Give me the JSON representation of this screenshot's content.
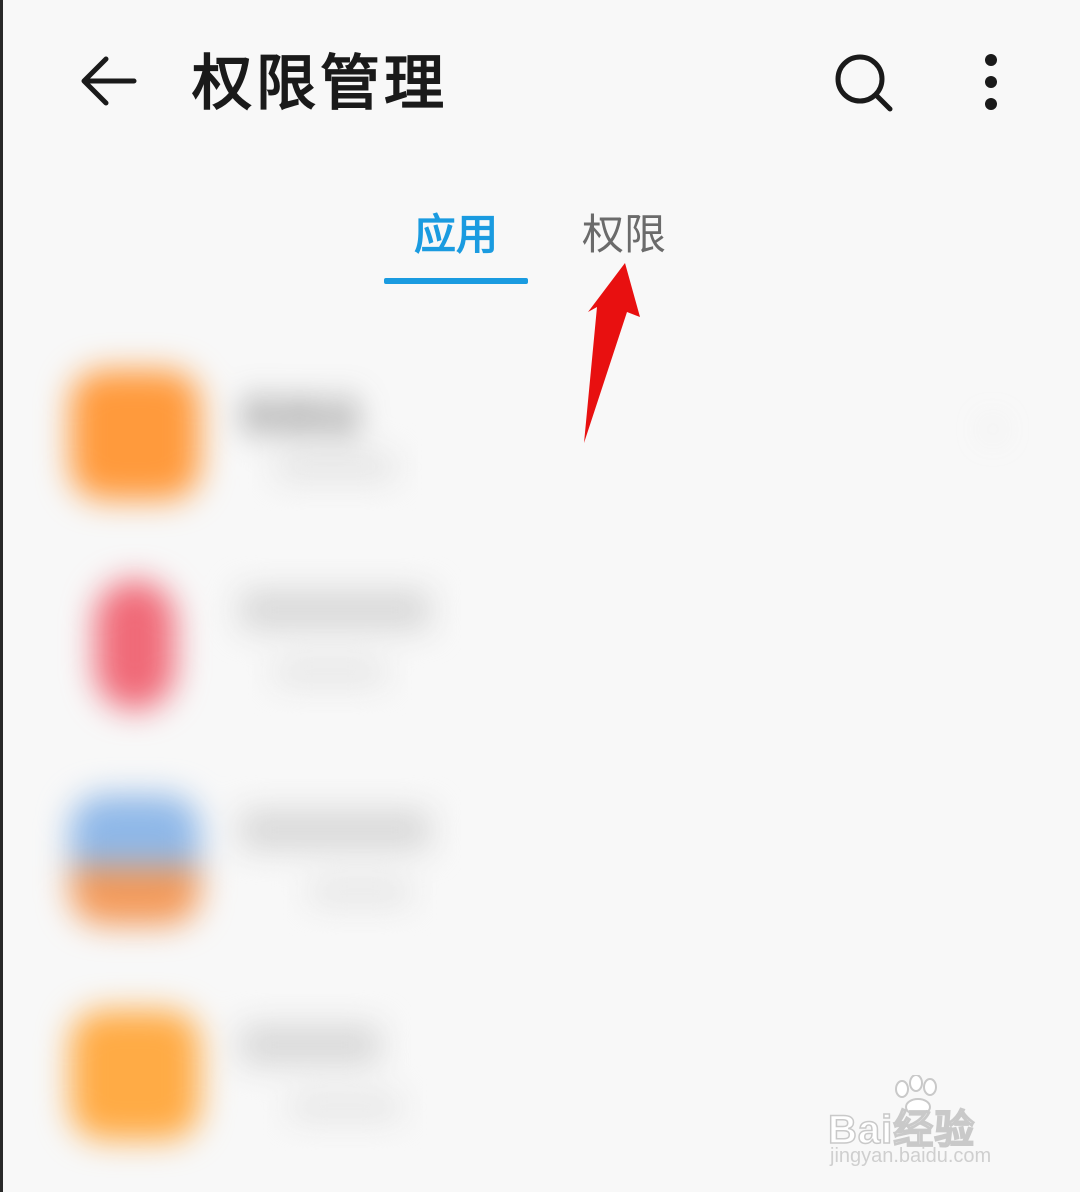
{
  "header": {
    "title": "权限管理",
    "back_icon": "back-arrow-icon",
    "search_icon": "search-icon",
    "more_icon": "more-vertical-icon"
  },
  "tabs": [
    {
      "label": "应用",
      "selected": true
    },
    {
      "label": "权限",
      "selected": false
    }
  ],
  "app_list": [
    {
      "name": "系统设",
      "icon_color": "#ff9a3c"
    },
    {
      "name": "",
      "icon_color": "#f06a78"
    },
    {
      "name": "",
      "icon_color": "#8fb8e8"
    },
    {
      "name": "",
      "icon_color": "#ffab45"
    }
  ],
  "annotation": {
    "type": "red-arrow",
    "color": "#e81010",
    "target": "tab-permissions"
  },
  "watermark": {
    "brand": "Bai经验",
    "url": "jingyan.baidu.com"
  },
  "colors": {
    "accent": "#1a9be0",
    "background": "#f8f8f8"
  }
}
